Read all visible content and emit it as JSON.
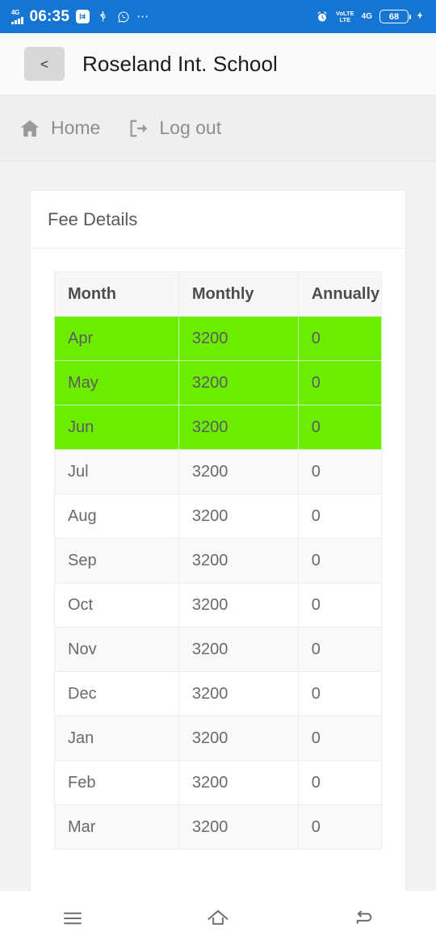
{
  "status_bar": {
    "network_label": "4G",
    "time": "06:35",
    "app_badge_icon": "app-badge-icon",
    "usb_icon": "usb-icon",
    "whatsapp_icon": "whatsapp-icon",
    "more_icon": "⋯",
    "alarm_icon": "alarm-clock-icon",
    "volte_top": "VoLTE",
    "volte_bottom": "LTE",
    "data_network": "4G",
    "battery_level": "68",
    "charging_icon": "⚡",
    "background_color": "#1476d2"
  },
  "app_bar": {
    "back_label": "<",
    "title": "Roseland Int. School"
  },
  "nav_strip": {
    "items": [
      {
        "label": "Home",
        "icon": "home-icon"
      },
      {
        "label": "Log out",
        "icon": "logout-icon"
      }
    ]
  },
  "card": {
    "title": "Fee Details"
  },
  "table": {
    "columns": [
      "Month",
      "Monthly",
      "Annually"
    ],
    "highlight_color": "#6ced00",
    "rows": [
      {
        "month": "Apr",
        "monthly": "3200",
        "annually": "0",
        "highlighted": true
      },
      {
        "month": "May",
        "monthly": "3200",
        "annually": "0",
        "highlighted": true
      },
      {
        "month": "Jun",
        "monthly": "3200",
        "annually": "0",
        "highlighted": true
      },
      {
        "month": "Jul",
        "monthly": "3200",
        "annually": "0",
        "highlighted": false
      },
      {
        "month": "Aug",
        "monthly": "3200",
        "annually": "0",
        "highlighted": false
      },
      {
        "month": "Sep",
        "monthly": "3200",
        "annually": "0",
        "highlighted": false
      },
      {
        "month": "Oct",
        "monthly": "3200",
        "annually": "0",
        "highlighted": false
      },
      {
        "month": "Nov",
        "monthly": "3200",
        "annually": "0",
        "highlighted": false
      },
      {
        "month": "Dec",
        "monthly": "3200",
        "annually": "0",
        "highlighted": false
      },
      {
        "month": "Jan",
        "monthly": "3200",
        "annually": "0",
        "highlighted": false
      },
      {
        "month": "Feb",
        "monthly": "3200",
        "annually": "0",
        "highlighted": false
      },
      {
        "month": "Mar",
        "monthly": "3200",
        "annually": "0",
        "highlighted": false
      }
    ]
  },
  "android_nav": {
    "recents_icon": "menu-icon",
    "home_icon": "home-outline-icon",
    "back_icon": "back-arrow-icon"
  }
}
